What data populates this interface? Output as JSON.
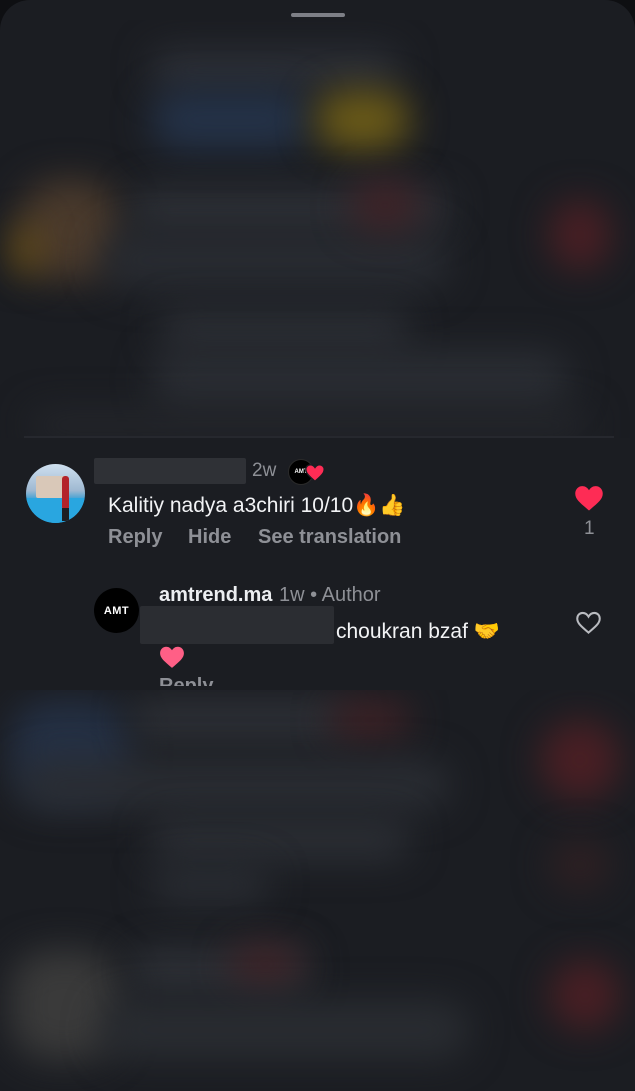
{
  "comment": {
    "time": "2w",
    "text": "Kalitiy nadya a3chiri 10/10🔥👍",
    "actions": {
      "reply": "Reply",
      "hide": "Hide",
      "see_translation": "See translation"
    },
    "like_count": "1",
    "liked_by_creator_badge": "AMT"
  },
  "reply": {
    "avatar_text": "AMT",
    "username": "amtrend.ma",
    "time": "1w",
    "separator": "•",
    "role": "Author",
    "text": "choukran bzaf 🤝",
    "emoji_line": "heart",
    "cut_label": "Reply"
  },
  "colors": {
    "background": "#1b1d22",
    "heart_red": "#fe2c55",
    "heart_pink": "#ff5f86",
    "muted_text": "#8e9096"
  },
  "icons": {
    "like_filled": "heart-filled-icon",
    "like_outline": "heart-outline-icon",
    "creator_liked": "creator-heart-badge-icon"
  }
}
